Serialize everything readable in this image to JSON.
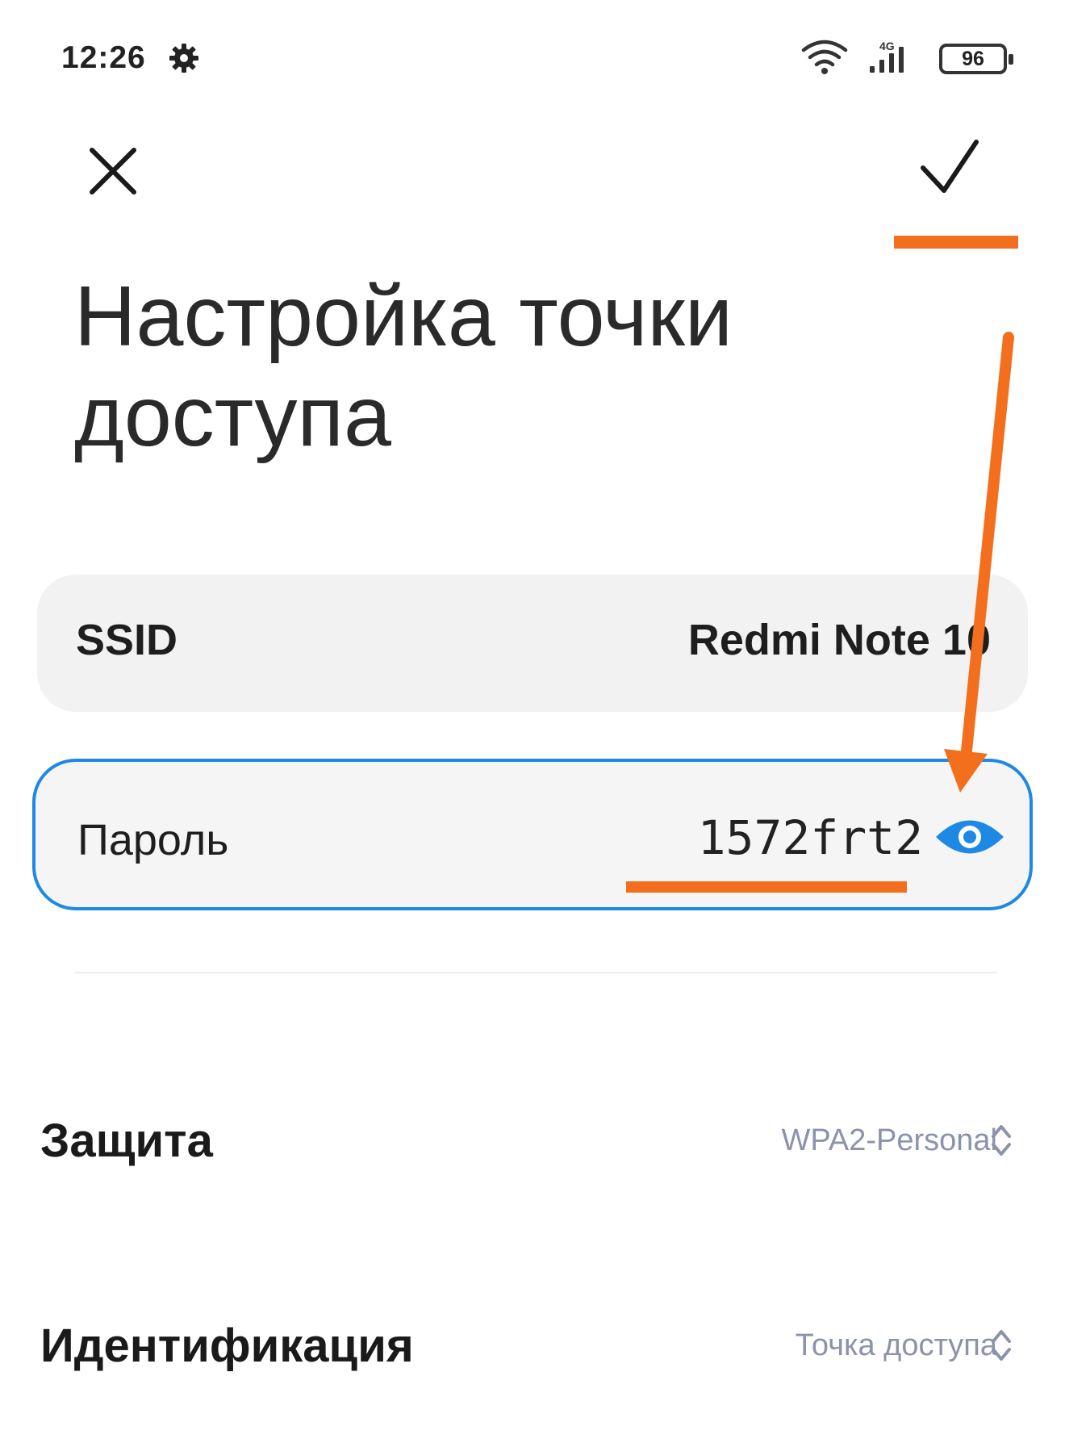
{
  "status_bar": {
    "time": "12:26",
    "network_label": "4G",
    "battery": "96",
    "icons": [
      "gear-icon",
      "wifi-icon",
      "signal-icon",
      "battery-icon"
    ]
  },
  "toolbar": {
    "close_icon": "close-icon",
    "confirm_icon": "check-icon"
  },
  "page": {
    "title": "Настройка точки доступа"
  },
  "fields": {
    "ssid": {
      "label": "SSID",
      "value": "Redmi Note 10"
    },
    "password": {
      "label": "Пароль",
      "value": "1572frt2",
      "toggle_icon": "eye-icon"
    }
  },
  "settings": [
    {
      "label": "Защита",
      "value": "WPA2-Personal"
    },
    {
      "label": "Идентификация",
      "value": "Точка доступа"
    }
  ],
  "colors": {
    "accent": "#1e88e5",
    "annotation": "#f36f1e",
    "secondary_text": "#8a93ab"
  }
}
